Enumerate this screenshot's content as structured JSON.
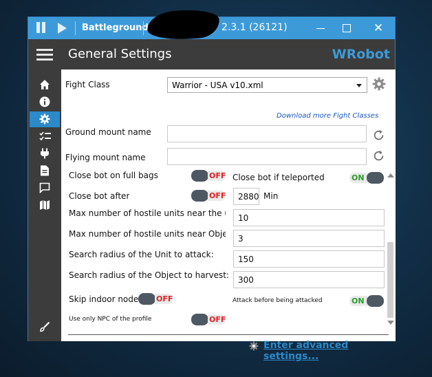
{
  "titlebar": {
    "app_name": "Battlegrounder",
    "version": "2.3.1 (26121)",
    "close_glyph": "✕"
  },
  "header": {
    "title": "General Settings",
    "brand": "WRobot"
  },
  "sidebar": {
    "items": [
      {
        "icon": "home-icon"
      },
      {
        "icon": "info-icon"
      },
      {
        "icon": "gear-icon",
        "active": true
      },
      {
        "icon": "checklist-icon"
      },
      {
        "icon": "plug-icon"
      },
      {
        "icon": "document-icon"
      },
      {
        "icon": "chat-icon"
      },
      {
        "icon": "map-icon"
      },
      {
        "icon": "brush-icon"
      }
    ],
    "active_color": "#2c8ac9"
  },
  "settings": {
    "fight_class_label": "Fight Class",
    "fight_class_value": "Warrior - USA v10.xml",
    "download_link": "Download more Fight Classes",
    "ground_mount_label": "Ground mount name",
    "ground_mount_value": "",
    "flying_mount_label": "Flying mount name",
    "flying_mount_value": "",
    "close_full_bags_label": "Close bot on full bags",
    "close_full_bags_state": "OFF",
    "close_teleported_label": "Close bot if teleported",
    "close_teleported_state": "ON",
    "close_after_label": "Close bot after",
    "close_after_state": "OFF",
    "close_after_value": "2880",
    "close_after_unit": "Min",
    "max_hostile_unit_label": "Max number of hostile units near the unit to",
    "max_hostile_unit_value": "10",
    "max_hostile_object_label": "Max number of hostile units near Object to",
    "max_hostile_object_value": "3",
    "search_unit_label": "Search radius of the Unit to attack:",
    "search_unit_value": "150",
    "search_object_label": "Search radius of the Object to harvest:",
    "search_object_value": "300",
    "skip_indoor_label": "Skip indoor nodes",
    "skip_indoor_state": "OFF",
    "attack_before_label": "Attack before being attacked",
    "attack_before_state": "ON",
    "use_npc_label": "Use only NPC of the profile",
    "use_npc_state": "OFF"
  },
  "footer": {
    "advanced_link": "Enter advanced settings..."
  },
  "colors": {
    "titlebar": "#3d9ad9",
    "header": "#3c3c3c",
    "toggle_on": "#2a9d2a",
    "toggle_off": "#e02222"
  }
}
